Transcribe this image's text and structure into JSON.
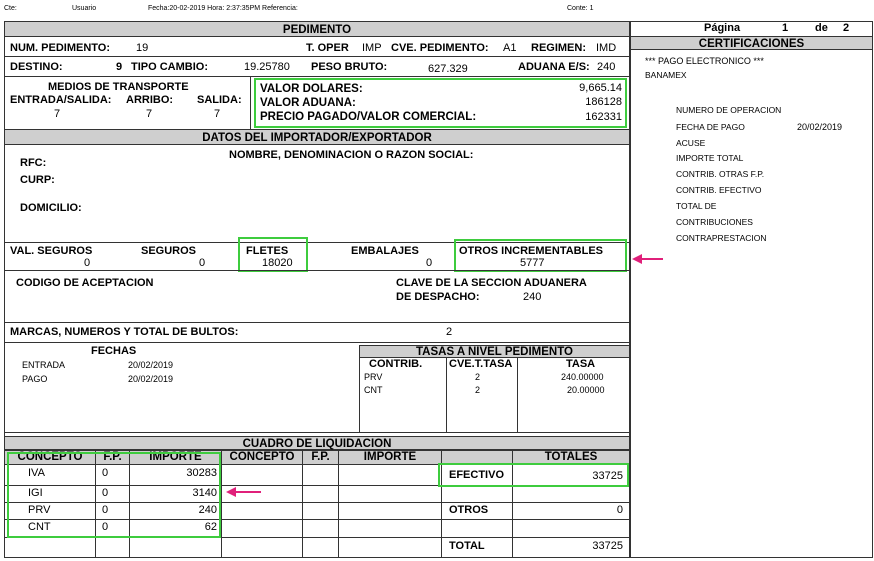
{
  "top": {
    "cte_label": "Cte:",
    "usuario_label": "Usuario",
    "fecha": "Fecha:20-02-2019 Hora: 2:37:35PM Referencia:",
    "conte": "Conte: 1"
  },
  "page": {
    "label": "Página",
    "num": "1",
    "de": "de",
    "total": "2"
  },
  "pedimento": {
    "header": "PEDIMENTO",
    "num_label": "NUM. PEDIMENTO:",
    "num_value": "19",
    "toper_label": "T. OPER",
    "toper_value": "IMP",
    "cve_label": "CVE. PEDIMENTO:",
    "cve_value": "A1",
    "regimen_label": "REGIMEN:",
    "regimen_value": "IMD",
    "destino_label": "DESTINO:",
    "destino_value": "9",
    "tipo_cambio_label": "TIPO CAMBIO:",
    "tipo_cambio_value": "19.25780",
    "peso_label": "PESO BRUTO:",
    "peso_value": "627.329",
    "aduana_label": "ADUANA E/S:",
    "aduana_value": "240",
    "medios_label": "MEDIOS DE TRANSPORTE",
    "entrada_label": "ENTRADA/SALIDA:",
    "arribo_label": "ARRIBO:",
    "salida_label": "SALIDA:",
    "entrada_value": "7",
    "arribo_value": "7",
    "salida_value": "7",
    "valor_dolares_label": "VALOR DOLARES:",
    "valor_dolares_value": "9,665.14",
    "valor_aduana_label": "VALOR ADUANA:",
    "valor_aduana_value": "186128",
    "precio_label": "PRECIO PAGADO/VALOR COMERCIAL:",
    "precio_value": "162331"
  },
  "importador": {
    "header": "DATOS DEL IMPORTADOR/EXPORTADOR",
    "rfc_label": "RFC:",
    "nombre_label": "NOMBRE, DENOMINACION O RAZON SOCIAL:",
    "curp_label": "CURP:",
    "domicilio_label": "DOMICILIO:"
  },
  "incrementables": {
    "val_seguros_label": "VAL. SEGUROS",
    "val_seguros_value": "0",
    "seguros_label": "SEGUROS",
    "seguros_value": "0",
    "fletes_label": "FLETES",
    "fletes_value": "18020",
    "embalajes_label": "EMBALAJES",
    "embalajes_value": "0",
    "otros_label": "OTROS INCREMENTABLES",
    "otros_value": "5777"
  },
  "aceptacion": {
    "codigo_label": "CODIGO DE ACEPTACION",
    "clave_label1": "CLAVE DE LA SECCION ADUANERA",
    "clave_label2": "DE DESPACHO:",
    "clave_value": "240"
  },
  "marcas": {
    "label": "MARCAS, NUMEROS Y TOTAL DE BULTOS:",
    "value": "2"
  },
  "fechas": {
    "header": "FECHAS",
    "rows": [
      {
        "label": "ENTRADA",
        "value": "20/02/2019"
      },
      {
        "label": "PAGO",
        "value": "20/02/2019"
      }
    ]
  },
  "tasas": {
    "header": "TASAS A NIVEL PEDIMENTO",
    "col_contrib": "CONTRIB.",
    "col_cve": "CVE.T.TASA",
    "col_tasa": "TASA",
    "rows": [
      {
        "contrib": "PRV",
        "cve": "2",
        "tasa": "240.00000"
      },
      {
        "contrib": "CNT",
        "cve": "2",
        "tasa": "20.00000"
      }
    ]
  },
  "liquidacion": {
    "header": "CUADRO DE LIQUIDACION",
    "col_concepto": "CONCEPTO",
    "col_fp": "F.P.",
    "col_importe": "IMPORTE",
    "col_concepto2": "CONCEPTO",
    "col_fp2": "F.P.",
    "col_importe2": "IMPORTE",
    "col_totales": "TOTALES",
    "rows": [
      {
        "concepto": "IVA",
        "fp": "0",
        "importe": "30283"
      },
      {
        "concepto": "IGI",
        "fp": "0",
        "importe": "3140"
      },
      {
        "concepto": "PRV",
        "fp": "0",
        "importe": "240"
      },
      {
        "concepto": "CNT",
        "fp": "0",
        "importe": "62"
      }
    ],
    "efectivo_label": "EFECTIVO",
    "efectivo_value": "33725",
    "otros_label": "OTROS",
    "otros_value": "0",
    "total_label": "TOTAL",
    "total_value": "33725"
  },
  "certificaciones": {
    "header": "CERTIFICACIONES",
    "pago": "*** PAGO ELECTRONICO ***",
    "banco": "BANAMEX",
    "numero_operacion": "NUMERO DE OPERACION",
    "fecha_pago_label": "FECHA DE PAGO",
    "fecha_pago_value": "20/02/2019",
    "acuse": "ACUSE",
    "importe_total": "IMPORTE TOTAL",
    "contrib_otras": "CONTRIB. OTRAS F.P.",
    "contrib_efectivo": "CONTRIB. EFECTIVO",
    "total_de": "TOTAL DE",
    "contribuciones": "CONTRIBUCIONES",
    "contraprestacion": "CONTRAPRESTACION"
  },
  "colors": {
    "highlight": "#3ecc3e",
    "arrow": "#e0207a",
    "header_bg": "#cfcfcf"
  }
}
